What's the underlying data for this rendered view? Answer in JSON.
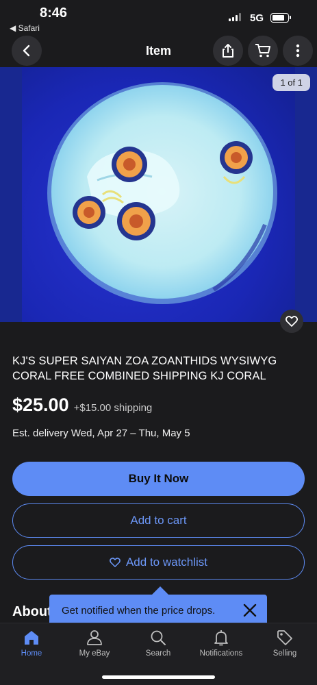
{
  "status_bar": {
    "time": "8:46",
    "back_app": "◀ Safari",
    "network": "5G"
  },
  "nav": {
    "title": "Item",
    "icons": [
      "back-icon",
      "share-icon",
      "cart-icon",
      "more-icon"
    ]
  },
  "gallery": {
    "counter": "1 of 1",
    "icons": [
      "heart-icon"
    ]
  },
  "listing": {
    "title": "KJ'S SUPER SAIYAN ZOA ZOANTHIDS WYSIWYG CORAL FREE COMBINED SHIPPING KJ CORAL",
    "price": "$25.00",
    "shipping": "+$15.00 shipping",
    "delivery": "Est. delivery Wed, Apr 27 – Thu, May 5"
  },
  "actions": {
    "buy_now": "Buy It Now",
    "add_to_cart": "Add to cart",
    "add_to_watchlist": "Add to watchlist"
  },
  "about": {
    "heading": "About this item"
  },
  "tooltip": {
    "text": "Get notified when the price drops."
  },
  "tabs": [
    {
      "label": "Home",
      "icon": "home-icon",
      "active": true
    },
    {
      "label": "My eBay",
      "icon": "person-icon",
      "active": false
    },
    {
      "label": "Search",
      "icon": "search-icon",
      "active": false
    },
    {
      "label": "Notifications",
      "icon": "bell-icon",
      "active": false
    },
    {
      "label": "Selling",
      "icon": "tag-icon",
      "active": false
    }
  ],
  "colors": {
    "accent": "#5e8cf5",
    "background": "#1b1b1d",
    "photo_blue": "#1a27b5"
  }
}
